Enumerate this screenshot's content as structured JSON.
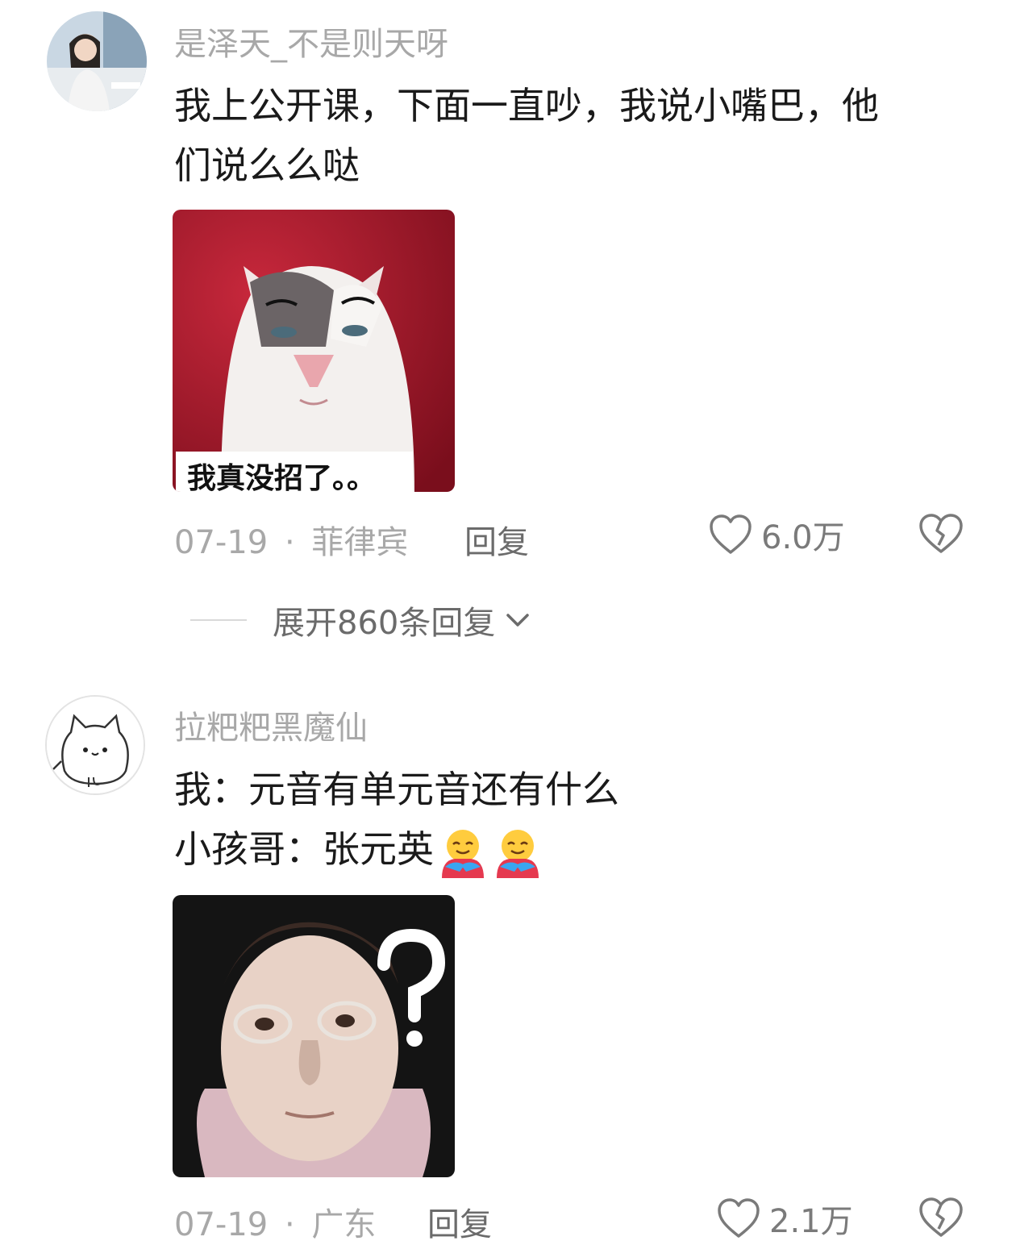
{
  "comments": [
    {
      "username": "是泽天_不是则天呀",
      "lines": [
        "我上公开课，下面一直吵，我说小嘴巴，他",
        "们说么么哒"
      ],
      "sticker_caption": "我真没招了。。",
      "date": "07-19",
      "separator": "·",
      "location": "菲律宾",
      "reply_label": "回复",
      "likes": "6.0万",
      "expand_label": "展开860条回复"
    },
    {
      "username": "拉粑粑黑魔仙",
      "lines": [
        "我：元音有单元音还有什么",
        "小孩哥：张元英"
      ],
      "emoji": [
        "hugging-face-emoji",
        "hugging-face-emoji"
      ],
      "date": "07-19",
      "separator": "·",
      "location": "广东",
      "reply_label": "回复",
      "likes": "2.1万"
    }
  ],
  "icons": {
    "like": "heart-outline-icon",
    "dislike": "broken-heart-icon",
    "expand": "chevron-down-icon"
  },
  "colors": {
    "text": "#1a1a1a",
    "muted": "#a8a8a8",
    "action": "#6b6b6b"
  }
}
